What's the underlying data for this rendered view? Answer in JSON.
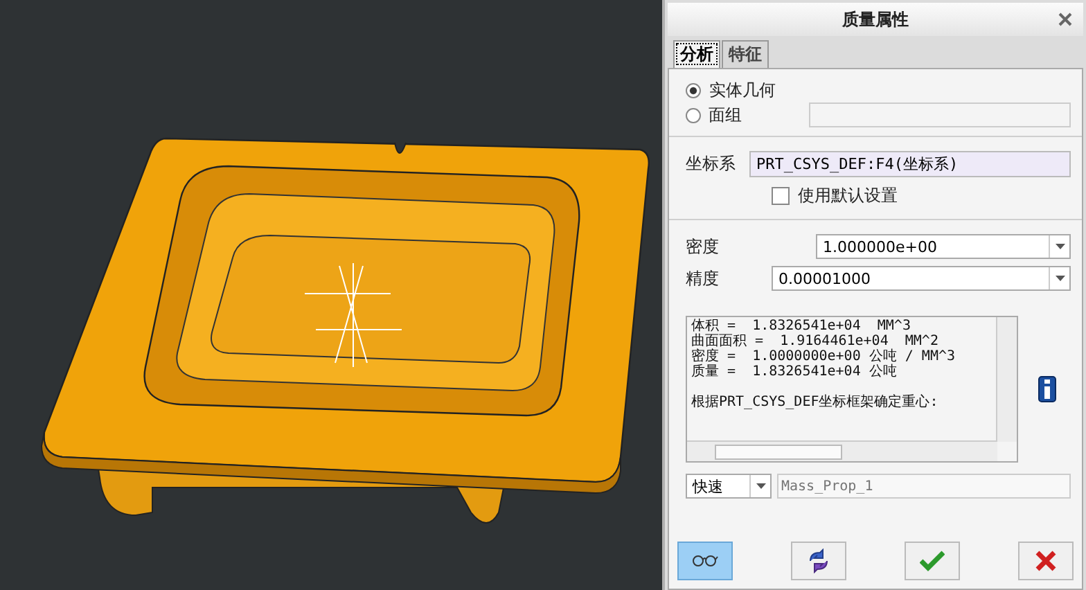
{
  "window": {
    "title": "质量属性"
  },
  "tabs": [
    {
      "label": "分析",
      "selected": true
    },
    {
      "label": "特征",
      "selected": false
    }
  ],
  "geometry_options": [
    {
      "label": "实体几何",
      "selected": true
    },
    {
      "label": "面组",
      "selected": false
    }
  ],
  "coordinate_system": {
    "label": "坐标系",
    "value": "PRT_CSYS_DEF:F4(坐标系)"
  },
  "use_default": {
    "label": "使用默认设置",
    "checked": false
  },
  "density": {
    "label": "密度",
    "value": "1.000000e+00"
  },
  "precision": {
    "label": "精度",
    "value": "0.00001000"
  },
  "results": {
    "lines": [
      "体积 =  1.8326541e+04  MM^3",
      "曲面面积 =  1.9164461e+04  MM^2",
      "密度 =  1.0000000e+00 公吨 / MM^3",
      "质量 =  1.8326541e+04 公吨"
    ],
    "note": "根据PRT_CSYS_DEF坐标框架确定重心:"
  },
  "mode": {
    "value": "快速"
  },
  "name_field": {
    "placeholder": "Mass_Prop_1"
  },
  "buttons": [
    {
      "kind": "preview",
      "selected": true
    },
    {
      "kind": "refresh",
      "selected": false
    },
    {
      "kind": "ok",
      "selected": false
    },
    {
      "kind": "cancel",
      "selected": false
    }
  ]
}
